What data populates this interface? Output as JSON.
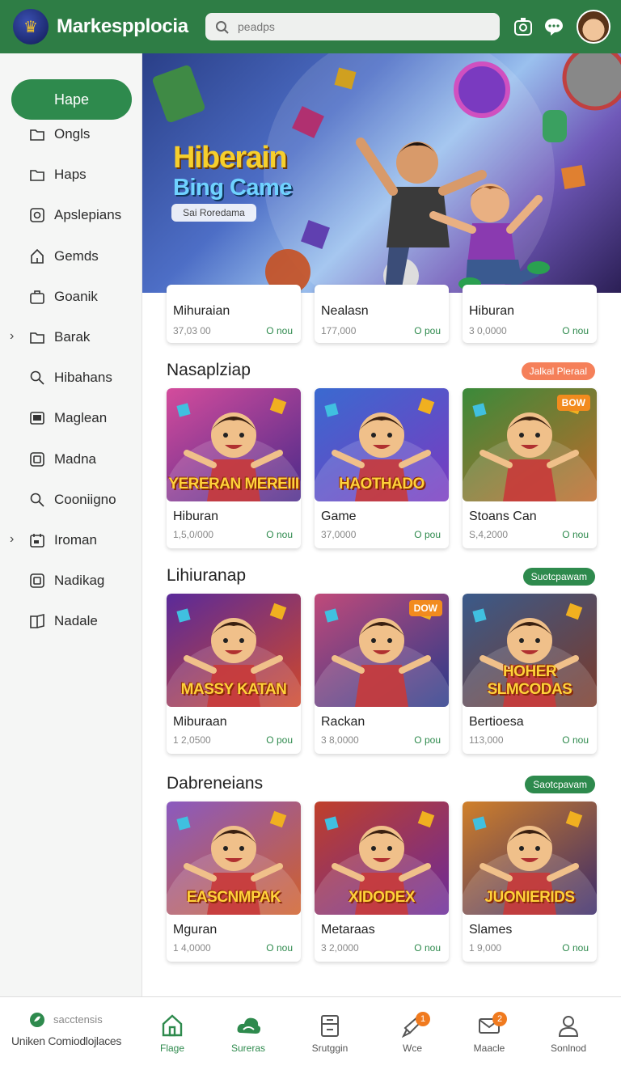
{
  "header": {
    "brand": "Markespplocia",
    "search_placeholder": "peadps",
    "icons": [
      "camera-icon",
      "chat-bubble-icon"
    ]
  },
  "sidebar": {
    "active_label": "Hape",
    "items": [
      {
        "label": "Ongls",
        "icon": "folder-icon"
      },
      {
        "label": "Haps",
        "icon": "folder-icon"
      },
      {
        "label": "Apslepians",
        "icon": "app-icon"
      },
      {
        "label": "Gemds",
        "icon": "home-icon"
      },
      {
        "label": "Goanik",
        "icon": "briefcase-icon"
      },
      {
        "label": "Barak",
        "icon": "folder-icon",
        "expandable": true
      },
      {
        "label": "Hibahans",
        "icon": "search-icon"
      },
      {
        "label": "Maglean",
        "icon": "monitor-icon"
      },
      {
        "label": "Madna",
        "icon": "square-icon"
      },
      {
        "label": "Cooniigno",
        "icon": "search-icon"
      },
      {
        "label": "Iroman",
        "icon": "calendar-icon",
        "expandable": true
      },
      {
        "label": "Nadikag",
        "icon": "square-icon"
      },
      {
        "label": "Nadale",
        "icon": "book-icon"
      }
    ]
  },
  "hero": {
    "title_line1": "Hiberain",
    "title_line2": "Bing Came",
    "button_label": "Sai Roredama"
  },
  "top_row": [
    {
      "title": "Mihuraian",
      "price": "37,03 00",
      "status": "O nou"
    },
    {
      "title": "Nealasn",
      "price": "177,000",
      "status": "O pou"
    },
    {
      "title": "Hiburan",
      "price": "3 0,0000",
      "status": "O nou"
    }
  ],
  "sections": [
    {
      "title": "Nasaplziap",
      "pill": "Jalkal Pleraal",
      "pill_color": "#f07a55",
      "cards": [
        {
          "title": "Hiburan",
          "price": "1,5,0/000",
          "status": "O nou",
          "art": "YERERAN MEREIII",
          "colors": [
            "#d44c9c",
            "#4a2a8a"
          ]
        },
        {
          "title": "Game",
          "price": "37,0000",
          "status": "O pou",
          "art": "HAOTHADO",
          "colors": [
            "#3a6ad0",
            "#7a3ac0"
          ]
        },
        {
          "title": "Stoans Can",
          "price": "S,4,2000",
          "status": "O nou",
          "art": "",
          "badge": "BOW",
          "colors": [
            "#3a8a3a",
            "#c06a2a"
          ]
        }
      ]
    },
    {
      "title": "Lihiuranap",
      "pill": "Suotcpawam",
      "pill_color": "#2e8a4d",
      "cards": [
        {
          "title": "Miburaan",
          "price": "1 2,0500",
          "status": "O pou",
          "art": "MASSY KATAN",
          "colors": [
            "#5a2a9a",
            "#d0482a"
          ]
        },
        {
          "title": "Rackan",
          "price": "3 8,0000",
          "status": "O pou",
          "art": "",
          "badge": "DOW",
          "colors": [
            "#c04a7a",
            "#2a3a8a"
          ]
        },
        {
          "title": "Bertioesa",
          "price": "113,000",
          "status": "O nou",
          "art": "HOHER SLMCODAS",
          "colors": [
            "#3a5a8a",
            "#7a3a2a"
          ]
        }
      ]
    },
    {
      "title": "Dabreneians",
      "pill": "Saotcpavam",
      "pill_color": "#2e8a4d",
      "cards": [
        {
          "title": "Mguran",
          "price": "1 4,0000",
          "status": "O nou",
          "art": "EASCNMPAK",
          "colors": [
            "#8a5ac0",
            "#d0602a"
          ]
        },
        {
          "title": "Metaraas",
          "price": "3 2,0000",
          "status": "O nou",
          "art": "XIDODEX",
          "colors": [
            "#c0402a",
            "#6a2a9a"
          ]
        },
        {
          "title": "Slames",
          "price": "1 9,000",
          "status": "O nou",
          "art": "JUONIERIDS",
          "colors": [
            "#d0802a",
            "#3a2a6a"
          ]
        }
      ]
    }
  ],
  "bottom": {
    "promo_small": "sacctensis",
    "promo_big": "Uniken Comiodlojlaces",
    "nav": [
      {
        "label": "Flage",
        "icon": "home-icon",
        "active": true
      },
      {
        "label": "Sureras",
        "icon": "cloud-icon",
        "active": true
      },
      {
        "label": "Srutggin",
        "icon": "calculator-icon"
      },
      {
        "label": "Wce",
        "icon": "rocket-icon",
        "badge": "1"
      },
      {
        "label": "Maacle",
        "icon": "mail-icon",
        "badge": "2"
      },
      {
        "label": "Sonlnod",
        "icon": "user-icon"
      }
    ]
  },
  "colors": {
    "accent": "#2e7d45",
    "accent_light": "#2e8a4d",
    "orange": "#f07a1e"
  }
}
